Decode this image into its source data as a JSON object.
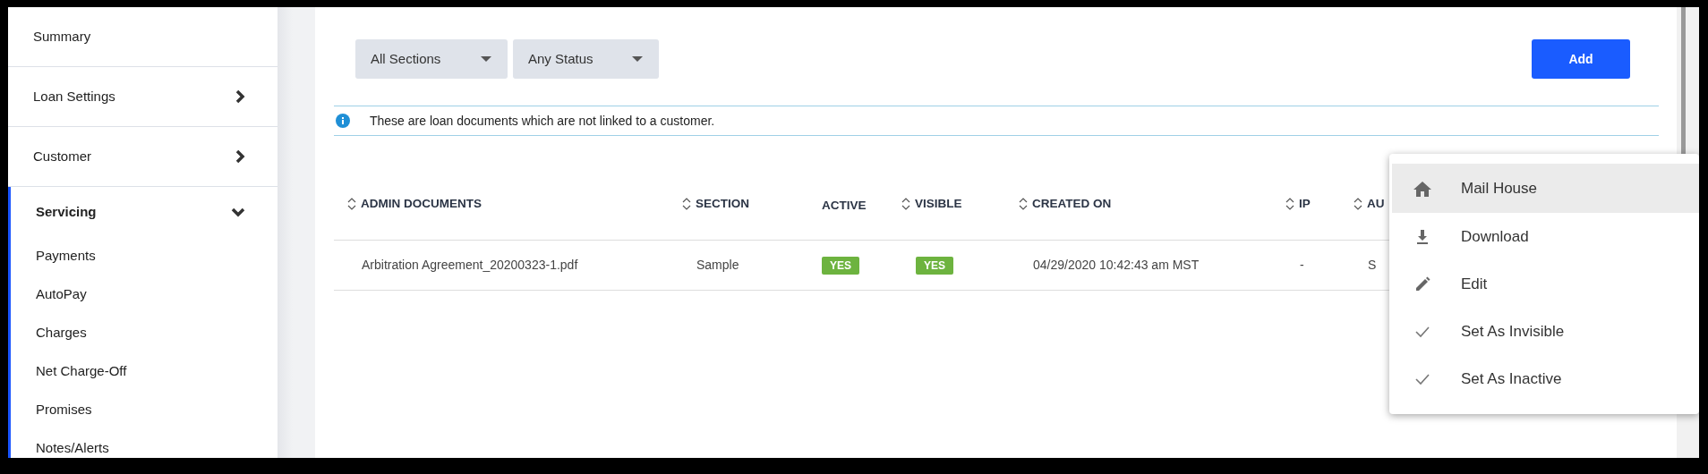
{
  "sidebar": {
    "items": [
      {
        "label": "Summary",
        "kind": "link",
        "selected": false
      },
      {
        "label": "Loan Settings",
        "kind": "group",
        "expanded": false,
        "selected": false
      },
      {
        "label": "Customer",
        "kind": "group",
        "expanded": false,
        "selected": false
      },
      {
        "label": "Servicing",
        "kind": "group",
        "expanded": true,
        "selected": true,
        "children": [
          {
            "label": "Payments",
            "selected": false
          },
          {
            "label": "AutoPay",
            "selected": false
          },
          {
            "label": "Charges",
            "selected": false
          },
          {
            "label": "Net Charge-Off",
            "selected": false
          },
          {
            "label": "Promises",
            "selected": false
          },
          {
            "label": "Notes/Alerts",
            "selected": false
          }
        ]
      }
    ]
  },
  "filters": [
    {
      "label": "All Sections"
    },
    {
      "label": "Any Status"
    }
  ],
  "add_button": {
    "label": "Add"
  },
  "info": {
    "text": "These are loan documents which are not linked to a customer."
  },
  "table": {
    "columns": [
      {
        "label": "ADMIN DOCUMENTS",
        "sortable": true
      },
      {
        "label": "SECTION",
        "sortable": true
      },
      {
        "label": "ACTIVE",
        "sortable": false
      },
      {
        "label": "VISIBLE",
        "sortable": true
      },
      {
        "label": "CREATED ON",
        "sortable": true
      },
      {
        "label": "IP",
        "sortable": true
      },
      {
        "label": "AU",
        "sortable": true
      }
    ],
    "rows": [
      {
        "cells": [
          {
            "kind": "text",
            "value": "Arbitration Agreement_20200323-1.pdf"
          },
          {
            "kind": "text",
            "value": "Sample"
          },
          {
            "kind": "badge",
            "value": "YES"
          },
          {
            "kind": "badge",
            "value": "YES"
          },
          {
            "kind": "text",
            "value": "04/29/2020 10:42:43 am MST"
          },
          {
            "kind": "text",
            "value": "-"
          },
          {
            "kind": "text",
            "value": "S"
          }
        ]
      }
    ]
  },
  "context_menu": {
    "items": [
      {
        "label": "Mail House",
        "selected": true
      },
      {
        "label": "Download",
        "selected": false
      },
      {
        "label": "Edit",
        "selected": false
      },
      {
        "label": "Set As Invisible",
        "selected": false
      },
      {
        "label": "Set As Inactive",
        "selected": false
      }
    ]
  }
}
